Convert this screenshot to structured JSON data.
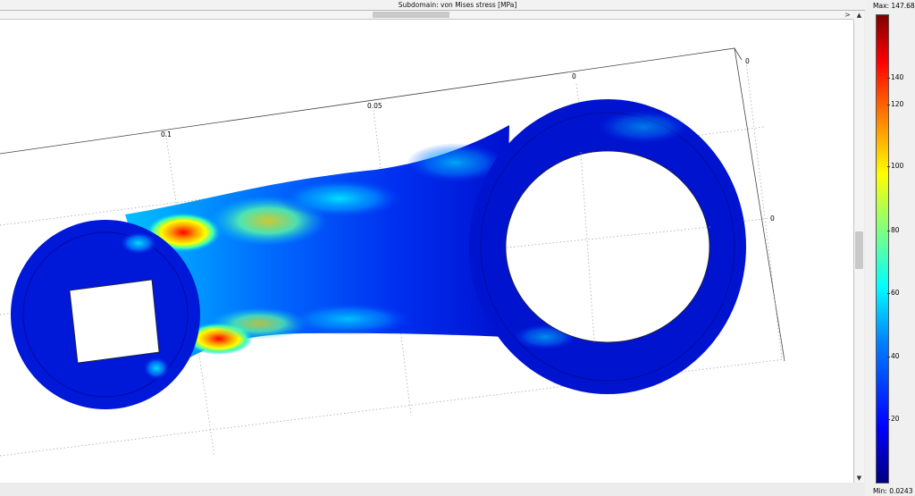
{
  "window": {
    "title": "Subdomain: von Mises stress [MPa]"
  },
  "axes": {
    "labels": [
      "0.1",
      "0.05",
      "0",
      "0",
      "0"
    ]
  },
  "colorbar": {
    "max_label": "Max: 147.683",
    "min_label": "Min: 0.0243",
    "ticks": [
      "140",
      "120",
      "100",
      "80",
      "60",
      "40",
      "20"
    ],
    "colors": [
      "#00007f",
      "#0000ff",
      "#0080ff",
      "#00ffff",
      "#80ff80",
      "#ffff00",
      "#ff8000",
      "#ff0000",
      "#7f0000"
    ]
  },
  "scroll": {
    "right_arrow": ">",
    "up_arrow": "▲",
    "down_arrow": "▼"
  }
}
